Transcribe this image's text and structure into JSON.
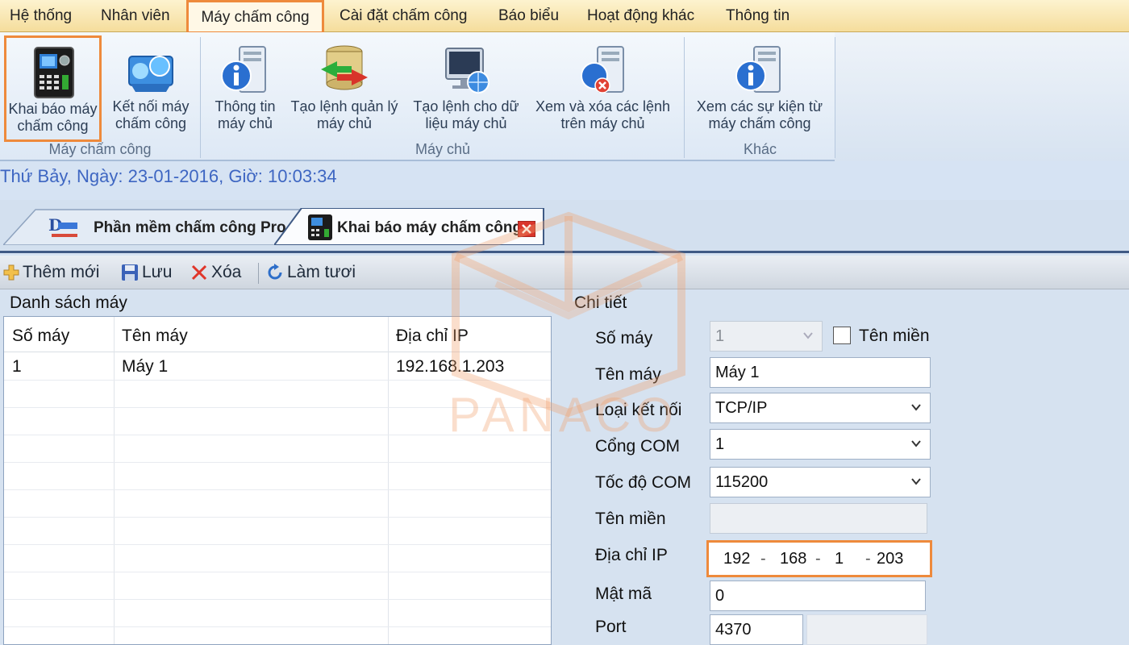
{
  "menu": {
    "items": [
      "Hệ thống",
      "Nhân viên",
      "Máy chấm công",
      "Cài đặt chấm công",
      "Báo biểu",
      "Hoạt động khác",
      "Thông tin"
    ]
  },
  "ribbon": {
    "groups": [
      {
        "label": "Máy chấm công",
        "buttons": [
          {
            "line1": "Khai báo máy",
            "line2": "chấm công",
            "icon": "fingerprint-device-icon"
          },
          {
            "line1": "Kết nối máy",
            "line2": "chấm công",
            "icon": "network-connect-icon"
          }
        ]
      },
      {
        "label": "Máy chủ",
        "buttons": [
          {
            "line1": "Thông tin",
            "line2": "máy chủ",
            "icon": "server-info-icon"
          },
          {
            "line1": "Tạo lệnh quản lý",
            "line2": "máy chủ",
            "icon": "database-command-icon"
          },
          {
            "line1": "Tạo lệnh cho dữ",
            "line2": "liệu máy chủ",
            "icon": "monitor-globe-icon"
          },
          {
            "line1": "Xem và xóa các lệnh",
            "line2": "trên máy chủ",
            "icon": "server-delete-icon"
          }
        ]
      },
      {
        "label": "Khác",
        "buttons": [
          {
            "line1": "Xem các sự kiện từ",
            "line2": "máy chấm công",
            "icon": "server-info-icon"
          }
        ]
      }
    ]
  },
  "status": {
    "datetime": "Thứ Bảy, Ngày: 23-01-2016, Giờ: 10:03:34"
  },
  "tabs": [
    {
      "label": "Phần mềm chấm công Pro"
    },
    {
      "label": "Khai báo máy chấm công"
    }
  ],
  "toolbar": {
    "add": "Thêm mới",
    "save": "Lưu",
    "delete": "Xóa",
    "refresh": "Làm tươi"
  },
  "list": {
    "title": "Danh sách máy",
    "columns": [
      "Số máy",
      "Tên máy",
      "Địa chỉ IP"
    ],
    "rows": [
      {
        "id": "1",
        "name": "Máy 1",
        "ip": "192.168.1.203"
      }
    ]
  },
  "detail": {
    "title": "Chi tiết",
    "labels": {
      "number": "Số máy",
      "name": "Tên máy",
      "conn_type": "Loại kết nối",
      "com_port": "Cổng COM",
      "com_speed": "Tốc độ COM",
      "domain": "Tên miền",
      "ip": "Địa chỉ IP",
      "password": "Mật mã",
      "port": "Port"
    },
    "domain_checkbox": "Tên miền",
    "values": {
      "number": "1",
      "name": "Máy 1",
      "conn_type": "TCP/IP",
      "com_port": "1",
      "com_speed": "115200",
      "domain": "",
      "ip_parts": [
        "192",
        "168",
        "1",
        "203"
      ],
      "password": "0",
      "port": "4370"
    }
  },
  "watermark": {
    "text": "PANACO"
  },
  "colors": {
    "highlight": "#ee8a3c",
    "menu_bg": "#f5dd9c",
    "date_text": "#3e66c2"
  }
}
